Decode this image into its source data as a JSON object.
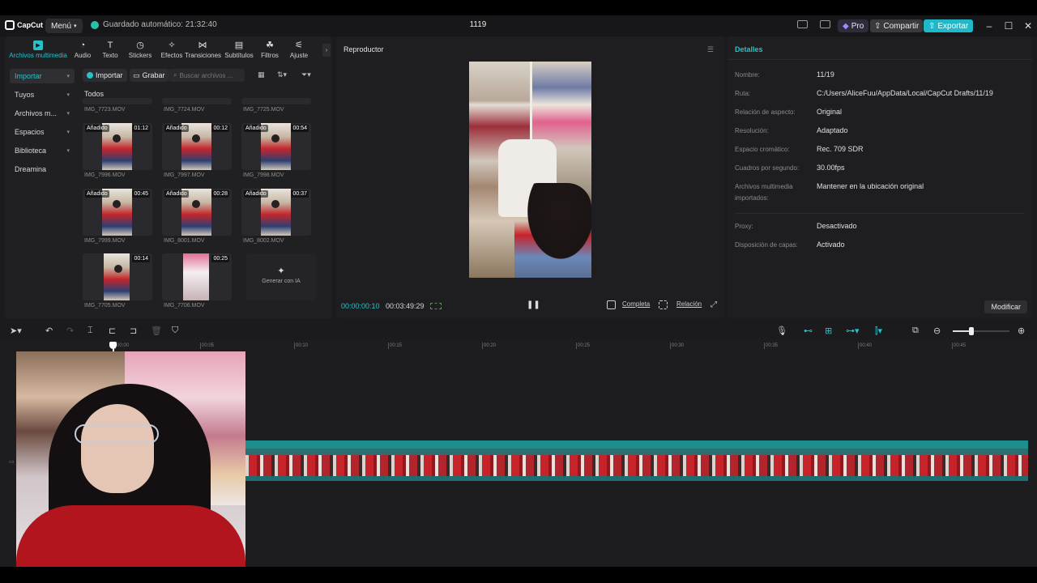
{
  "app": {
    "logo_text": "CapCut",
    "menu_label": "Menú",
    "autosave": "Guardado automático: 21:32:40",
    "project_title": "1119",
    "pro_label": "Pro",
    "share_label": "Compartir",
    "export_label": "Exportar",
    "accent": "#27c2c8"
  },
  "toolbar": {
    "items": [
      {
        "label": "Archivos multimedia",
        "icon": "media-icon",
        "active": true
      },
      {
        "label": "Audio",
        "icon": "audio-icon"
      },
      {
        "label": "Texto",
        "icon": "text-icon"
      },
      {
        "label": "Stickers",
        "icon": "sticker-icon"
      },
      {
        "label": "Efectos",
        "icon": "effects-icon"
      },
      {
        "label": "Transiciones",
        "icon": "transitions-icon"
      },
      {
        "label": "Subtítulos",
        "icon": "subtitles-icon"
      },
      {
        "label": "Filtros",
        "icon": "filters-icon"
      },
      {
        "label": "Ajuste",
        "icon": "adjust-icon"
      }
    ]
  },
  "sidebar": {
    "items": [
      {
        "label": "Importar",
        "active": true
      },
      {
        "label": "Tuyos"
      },
      {
        "label": "Archivos m..."
      },
      {
        "label": "Espacios"
      },
      {
        "label": "Biblioteca"
      },
      {
        "label": "Dreamina"
      }
    ]
  },
  "media": {
    "import_label": "Importar",
    "record_label": "Grabar",
    "search_placeholder": "Buscar archivos ...",
    "all_label": "Todos",
    "top_row": [
      "IMG_7723.MOV",
      "IMG_7724.MOV",
      "IMG_7725.MOV"
    ],
    "clips": [
      {
        "badge": "Añadido",
        "duration": "01:12",
        "name": "IMG_7996.MOV"
      },
      {
        "badge": "Añadido",
        "duration": "00:12",
        "name": "IMG_7997.MOV"
      },
      {
        "badge": "Añadido",
        "duration": "00:54",
        "name": "IMG_7998.MOV"
      },
      {
        "badge": "Añadido",
        "duration": "00:45",
        "name": "IMG_7999.MOV"
      },
      {
        "badge": "Añadido",
        "duration": "00:28",
        "name": "IMG_8001.MOV"
      },
      {
        "badge": "Añadido",
        "duration": "00:37",
        "name": "IMG_8002.MOV"
      },
      {
        "badge": "",
        "duration": "00:14",
        "name": "IMG_7705.MOV"
      },
      {
        "badge": "",
        "duration": "00:25",
        "name": "IMG_7706.MOV"
      }
    ],
    "generate_label": "Generar con IA"
  },
  "player": {
    "title": "Reproductor",
    "current_time": "00:00:00:10",
    "total_time": "00:03:49:29",
    "full_label": "Completa",
    "ratio_label": "Relación"
  },
  "details": {
    "title": "Detalles",
    "rows": [
      {
        "label": "Nombre:",
        "value": "11/19"
      },
      {
        "label": "Ruta:",
        "value": "C:/Users/AliceFuu/AppData/Local/CapCut Drafts/11/19"
      },
      {
        "label": "Relación de aspecto:",
        "value": "Original"
      },
      {
        "label": "Resolución:",
        "value": "Adaptado"
      },
      {
        "label": "Espacio cromático:",
        "value": "Rec. 709 SDR"
      },
      {
        "label": "Cuadros por segundo:",
        "value": "30.00fps"
      },
      {
        "label": "Archivos multimedia importados:",
        "value": "Mantener en la ubicación original"
      },
      {
        "label": "Proxy:",
        "value": "Desactivado"
      },
      {
        "label": "Disposición de capas:",
        "value": "Activado"
      }
    ],
    "modify_label": "Modificar"
  },
  "timeline": {
    "ruler": [
      "00:00",
      "00:05",
      "00:10",
      "00:15",
      "00:20",
      "00:25",
      "00:30",
      "00:35",
      "00:40",
      "00:45"
    ]
  }
}
